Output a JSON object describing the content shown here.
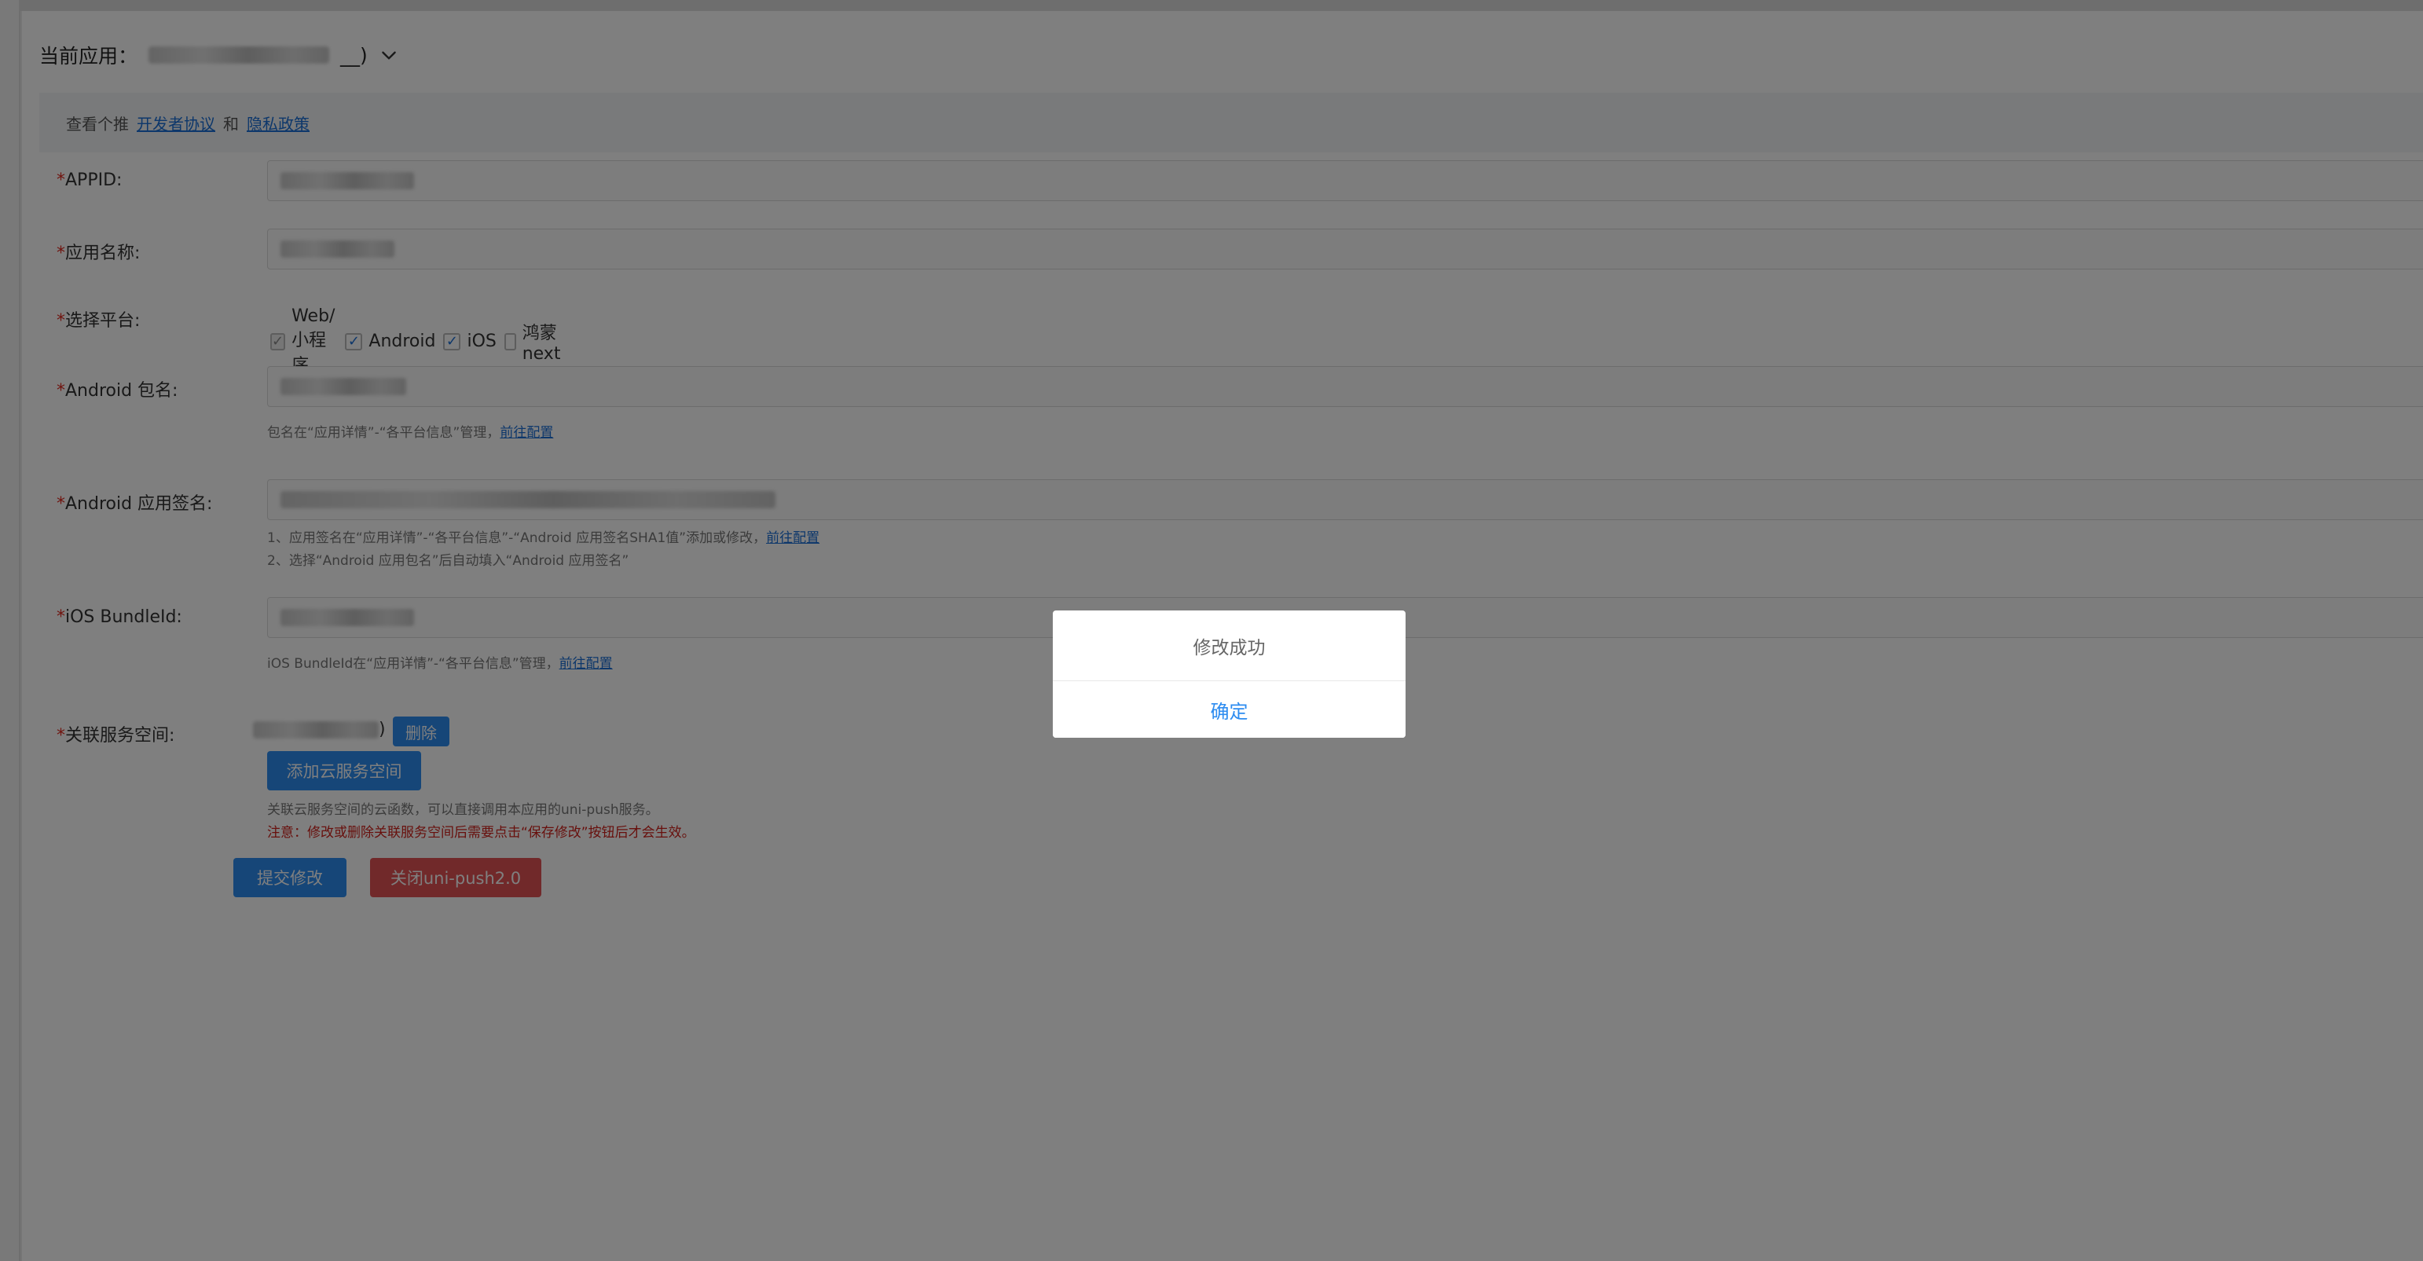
{
  "header": {
    "current_app_label": "当前应用：",
    "current_app_suffix": "__)"
  },
  "notice": {
    "prefix": "查看个推",
    "link_agreement": "开发者协议",
    "and": "和",
    "link_privacy": "隐私政策"
  },
  "form": {
    "required_mark": "*",
    "appid_label": "APPID:",
    "appname_label": "应用名称:",
    "platform_label": "选择平台:",
    "platforms": [
      {
        "name": "Web/小程序",
        "checked": true,
        "disabled": true
      },
      {
        "name": "Android",
        "checked": true,
        "disabled": false
      },
      {
        "name": "iOS",
        "checked": true,
        "disabled": false
      },
      {
        "name": "鸿蒙next",
        "checked": false,
        "disabled": false
      }
    ],
    "android_pkg_label": "Android 包名:",
    "android_pkg_hint": "包名在“应用详情”-“各平台信息”管理，",
    "android_pkg_link": "前往配置",
    "android_sign_label": "Android 应用签名:",
    "android_sign_hint1": "1、应用签名在“应用详情”-“各平台信息”-“Android 应用签名SHA1值”添加或修改，",
    "android_sign_link": "前往配置",
    "android_sign_hint2": "2、选择“Android 应用包名”后自动填入“Android 应用签名”",
    "ios_bundle_label": "iOS BundleId:",
    "ios_bundle_hint": "iOS BundleId在“应用详情”-“各平台信息”管理，",
    "ios_bundle_link": "前往配置",
    "service_space_label": "关联服务空间:",
    "service_space_suffix": ")",
    "delete_button": "删除",
    "add_space_button": "添加云服务空间",
    "space_hint": "关联云服务空间的云函数，可以直接调用本应用的uni-push服务。",
    "space_warning": "注意：修改或删除关联服务空间后需要点击“保存修改”按钮后才会生效。",
    "submit_button": "提交修改",
    "close_button": "关闭uni-push2.0"
  },
  "modal": {
    "message": "修改成功",
    "confirm": "确定"
  },
  "colors": {
    "primary": "#2d8cf0",
    "danger": "#e25355",
    "link": "#1a6fd6",
    "required": "#e0281e"
  }
}
